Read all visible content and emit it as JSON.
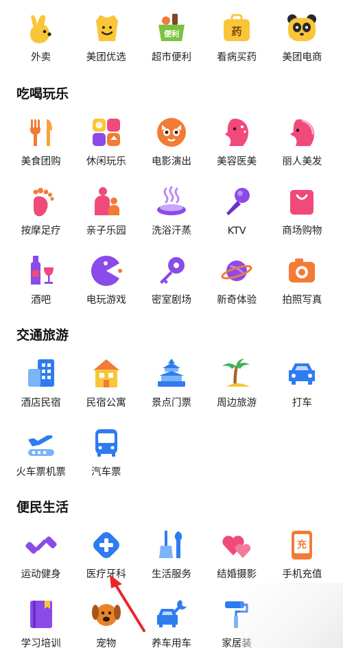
{
  "top_row": [
    {
      "label": "外卖",
      "icon": "kangaroo-icon"
    },
    {
      "label": "美团优选",
      "icon": "smiley-bag-icon"
    },
    {
      "label": "超市便利",
      "icon": "grocery-basket-icon"
    },
    {
      "label": "看病买药",
      "icon": "medicine-box-icon"
    },
    {
      "label": "美团电商",
      "icon": "panda-icon"
    }
  ],
  "sections": [
    {
      "title": "吃喝玩乐",
      "rows": [
        [
          {
            "label": "美食团购",
            "icon": "fork-knife-icon"
          },
          {
            "label": "休闲玩乐",
            "icon": "leisure-grid-icon"
          },
          {
            "label": "电影演出",
            "icon": "cat-face-icon"
          },
          {
            "label": "美容医美",
            "icon": "woman-profile-icon"
          },
          {
            "label": "丽人美发",
            "icon": "hair-profile-icon"
          }
        ],
        [
          {
            "label": "按摩足疗",
            "icon": "foot-icon"
          },
          {
            "label": "亲子乐园",
            "icon": "parent-child-icon"
          },
          {
            "label": "洗浴汗蒸",
            "icon": "steam-bath-icon"
          },
          {
            "label": "KTV",
            "icon": "microphone-icon"
          },
          {
            "label": "商场购物",
            "icon": "shopping-bag-icon"
          }
        ],
        [
          {
            "label": "酒吧",
            "icon": "wine-bottle-icon"
          },
          {
            "label": "电玩游戏",
            "icon": "pacman-icon"
          },
          {
            "label": "密室剧场",
            "icon": "key-icon"
          },
          {
            "label": "新奇体验",
            "icon": "planet-icon"
          },
          {
            "label": "拍照写真",
            "icon": "camera-icon"
          }
        ]
      ]
    },
    {
      "title": "交通旅游",
      "rows": [
        [
          {
            "label": "酒店民宿",
            "icon": "hotel-building-icon"
          },
          {
            "label": "民宿公寓",
            "icon": "house-icon"
          },
          {
            "label": "景点门票",
            "icon": "temple-icon"
          },
          {
            "label": "周边旅游",
            "icon": "palm-tree-icon"
          },
          {
            "label": "打车",
            "icon": "car-icon"
          }
        ],
        [
          {
            "label": "火车票机票",
            "icon": "plane-train-icon"
          },
          {
            "label": "汽车票",
            "icon": "bus-icon"
          }
        ]
      ]
    },
    {
      "title": "便民生活",
      "rows": [
        [
          {
            "label": "运动健身",
            "icon": "dumbbell-icon"
          },
          {
            "label": "医疗牙科",
            "icon": "medical-cross-icon"
          },
          {
            "label": "生活服务",
            "icon": "broom-wrench-icon"
          },
          {
            "label": "结婚摄影",
            "icon": "hearts-icon"
          },
          {
            "label": "手机充值",
            "icon": "phone-charge-icon"
          }
        ],
        [
          {
            "label": "学习培训",
            "icon": "book-icon"
          },
          {
            "label": "宠物",
            "icon": "dog-icon"
          },
          {
            "label": "养车用车",
            "icon": "car-wrench-icon"
          },
          {
            "label": "家居装",
            "icon": "paint-roller-icon"
          }
        ]
      ]
    }
  ],
  "icon_glyphs": {
    "phone_charge": "充",
    "medicine": "药",
    "grocery": "便利"
  },
  "colors": {
    "yellow": "#F9C63A",
    "orange": "#F27B35",
    "pink": "#F04A7A",
    "purple": "#8A4BE8",
    "blue": "#2F7BF0",
    "annotation": "#E8262A"
  }
}
